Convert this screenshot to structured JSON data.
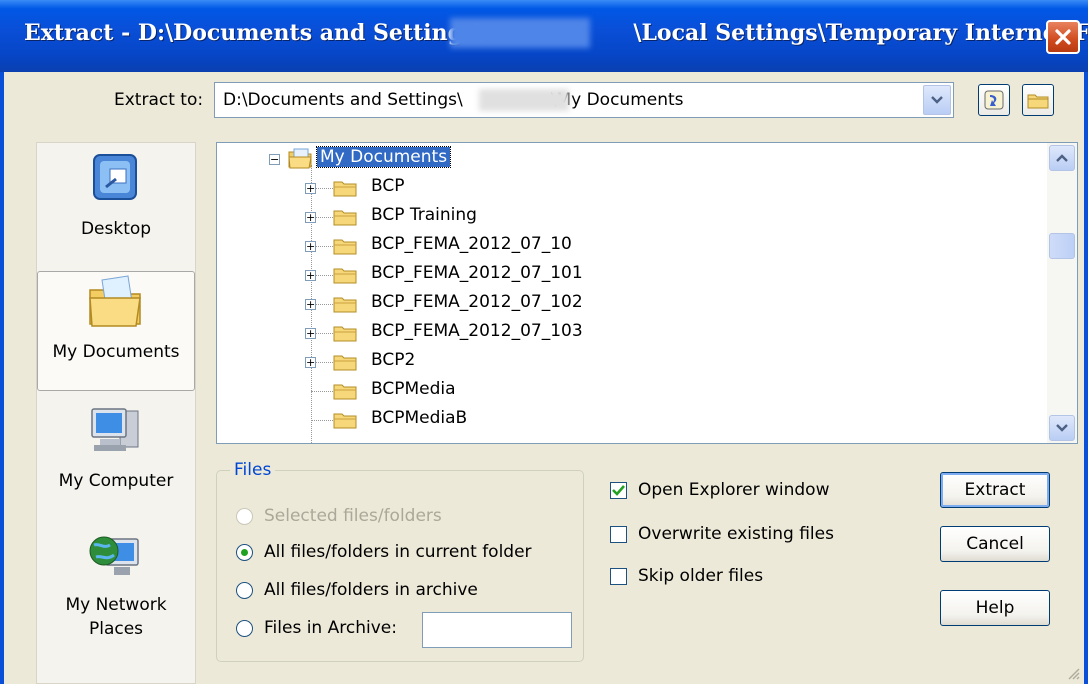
{
  "window": {
    "title_prefix": "Extract - D:\\Documents and Settings\\",
    "title_suffix": "\\Local Settings\\Temporary Internet Fil..."
  },
  "extract_to": {
    "label": "Extract to:",
    "path_prefix": "D:\\Documents and Settings\\",
    "path_suffix": "\\My Documents"
  },
  "places": [
    {
      "label": "Desktop",
      "icon": "desktop-icon"
    },
    {
      "label": "My Documents",
      "icon": "my-documents-icon",
      "selected": true
    },
    {
      "label": "My Computer",
      "icon": "my-computer-icon"
    },
    {
      "label": "My Network Places",
      "icon": "network-places-icon"
    }
  ],
  "tree": {
    "root": "My Documents",
    "items": [
      {
        "label": "BCP",
        "expandable": true
      },
      {
        "label": "BCP Training",
        "expandable": true
      },
      {
        "label": "BCP_FEMA_2012_07_10",
        "expandable": true
      },
      {
        "label": "BCP_FEMA_2012_07_101",
        "expandable": true
      },
      {
        "label": "BCP_FEMA_2012_07_102",
        "expandable": true
      },
      {
        "label": "BCP_FEMA_2012_07_103",
        "expandable": true
      },
      {
        "label": "BCP2",
        "expandable": true
      },
      {
        "label": "BCPMedia",
        "expandable": false
      },
      {
        "label": "BCPMediaB",
        "expandable": false
      }
    ]
  },
  "files_group": {
    "title": "Files",
    "options": [
      {
        "label": "Selected files/folders",
        "checked": false,
        "disabled": true
      },
      {
        "label": "All files/folders in current folder",
        "checked": true,
        "disabled": false
      },
      {
        "label": "All files/folders in archive",
        "checked": false,
        "disabled": false
      },
      {
        "label": "Files in Archive:",
        "checked": false,
        "disabled": false
      }
    ],
    "files_in_archive_value": ""
  },
  "options": [
    {
      "label": "Open Explorer window",
      "checked": true
    },
    {
      "label": "Overwrite existing files",
      "checked": false
    },
    {
      "label": "Skip older files",
      "checked": false
    }
  ],
  "buttons": {
    "extract": "Extract",
    "cancel": "Cancel",
    "help": "Help"
  }
}
